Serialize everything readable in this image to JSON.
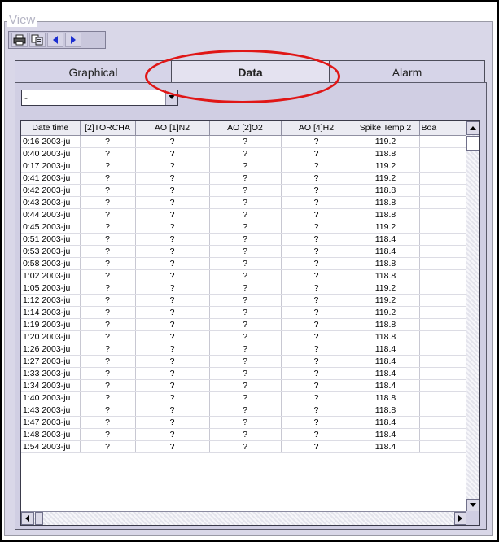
{
  "group": {
    "title": "View"
  },
  "toolbar": {
    "icons": [
      "printer-icon",
      "copy-icon",
      "arrow-left-icon",
      "arrow-right-icon"
    ]
  },
  "tabs": [
    {
      "label": "Graphical",
      "active": false
    },
    {
      "label": "Data",
      "active": true
    },
    {
      "label": "Alarm",
      "active": false
    }
  ],
  "filter": {
    "value": "-"
  },
  "table": {
    "columns": [
      "Date time",
      "[2]TORCHA",
      "AO  [1]N2",
      "AO  [2]O2",
      "AO  [4]H2",
      "Spike Temp 2",
      "Boa"
    ],
    "rows": [
      [
        "0:16 2003-ju",
        "?",
        "?",
        "?",
        "?",
        "119.2",
        ""
      ],
      [
        "0:40 2003-ju",
        "?",
        "?",
        "?",
        "?",
        "118.8",
        ""
      ],
      [
        "0:17 2003-ju",
        "?",
        "?",
        "?",
        "?",
        "119.2",
        ""
      ],
      [
        "0:41 2003-ju",
        "?",
        "?",
        "?",
        "?",
        "119.2",
        ""
      ],
      [
        "0:42 2003-ju",
        "?",
        "?",
        "?",
        "?",
        "118.8",
        ""
      ],
      [
        "0:43 2003-ju",
        "?",
        "?",
        "?",
        "?",
        "118.8",
        ""
      ],
      [
        "0:44 2003-ju",
        "?",
        "?",
        "?",
        "?",
        "118.8",
        ""
      ],
      [
        "0:45 2003-ju",
        "?",
        "?",
        "?",
        "?",
        "119.2",
        ""
      ],
      [
        "0:51 2003-ju",
        "?",
        "?",
        "?",
        "?",
        "118.4",
        ""
      ],
      [
        "0:53 2003-ju",
        "?",
        "?",
        "?",
        "?",
        "118.4",
        ""
      ],
      [
        "0:58 2003-ju",
        "?",
        "?",
        "?",
        "?",
        "118.8",
        ""
      ],
      [
        "1:02 2003-ju",
        "?",
        "?",
        "?",
        "?",
        "118.8",
        ""
      ],
      [
        "1:05 2003-ju",
        "?",
        "?",
        "?",
        "?",
        "119.2",
        ""
      ],
      [
        "1:12 2003-ju",
        "?",
        "?",
        "?",
        "?",
        "119.2",
        ""
      ],
      [
        "1:14 2003-ju",
        "?",
        "?",
        "?",
        "?",
        "119.2",
        ""
      ],
      [
        "1:19 2003-ju",
        "?",
        "?",
        "?",
        "?",
        "118.8",
        ""
      ],
      [
        "1:20 2003-ju",
        "?",
        "?",
        "?",
        "?",
        "118.8",
        ""
      ],
      [
        "1:26 2003-ju",
        "?",
        "?",
        "?",
        "?",
        "118.4",
        ""
      ],
      [
        "1:27 2003-ju",
        "?",
        "?",
        "?",
        "?",
        "118.4",
        ""
      ],
      [
        "1:33 2003-ju",
        "?",
        "?",
        "?",
        "?",
        "118.4",
        ""
      ],
      [
        "1:34 2003-ju",
        "?",
        "?",
        "?",
        "?",
        "118.4",
        ""
      ],
      [
        "1:40 2003-ju",
        "?",
        "?",
        "?",
        "?",
        "118.8",
        ""
      ],
      [
        "1:43 2003-ju",
        "?",
        "?",
        "?",
        "?",
        "118.8",
        ""
      ],
      [
        "1:47 2003-ju",
        "?",
        "?",
        "?",
        "?",
        "118.4",
        ""
      ],
      [
        "1:48 2003-ju",
        "?",
        "?",
        "?",
        "?",
        "118.4",
        ""
      ],
      [
        "1:54 2003-ju",
        "?",
        "?",
        "?",
        "?",
        "118.4",
        ""
      ]
    ]
  },
  "colors": {
    "panel": "#d9d7e8",
    "highlight_ellipse": "#e01616",
    "toolbar_arrow": "#1c2fd0"
  }
}
